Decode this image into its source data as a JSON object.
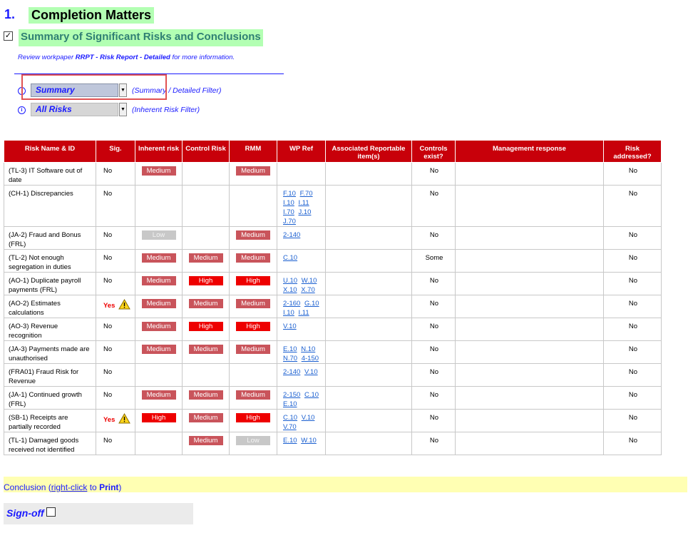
{
  "section": {
    "number": "1.",
    "title": "Completion Matters"
  },
  "summary": {
    "checked": true,
    "check_glyph": "✓",
    "title": "Summary of Significant Risks and Conclusions",
    "review_prefix": "Review workpaper",
    "review_link": "RRPT - Risk Report - Detailed",
    "review_suffix": "for more information."
  },
  "filters": [
    {
      "value": "Summary",
      "hint": "(Summary / Detailed Filter)",
      "info_glyph": "i",
      "arrow": "▼"
    },
    {
      "value": "All Risks",
      "hint": "(Inherent Risk Filter)",
      "info_glyph": "i",
      "arrow": "▼"
    }
  ],
  "colors": {
    "header_red": "#c8000a",
    "medium": "#c9545b",
    "high": "#ee0000",
    "low": "#c8c8c8",
    "link_blue": "#1a1aff"
  },
  "table": {
    "headers": [
      "Risk Name & ID",
      "Sig.",
      "Inherent risk",
      "Control Risk",
      "RMM",
      "WP Ref",
      "Associated Reportable item(s)",
      "Controls exist?",
      "Management response",
      "Risk addressed?"
    ],
    "rows": [
      {
        "name": "(TL-3) IT Software out of date",
        "sig": "No",
        "sig_warn": false,
        "inherent": "Medium",
        "control": "",
        "rmm": "Medium",
        "wp": [],
        "assoc": "",
        "controls": "No",
        "mgmt": "",
        "addressed": "No"
      },
      {
        "name": "(CH-1) Discrepancies",
        "sig": "No",
        "sig_warn": false,
        "inherent": "",
        "control": "",
        "rmm": "",
        "wp": [
          "F.10",
          "F.70",
          "I.10",
          "I.11",
          "I.70",
          "J.10",
          "J.70"
        ],
        "assoc": "",
        "controls": "No",
        "mgmt": "",
        "addressed": "No"
      },
      {
        "name": "(JA-2) Fraud and Bonus (FRL)",
        "sig": "No",
        "sig_warn": false,
        "inherent": "Low",
        "control": "",
        "rmm": "Medium",
        "wp": [
          "2-140"
        ],
        "assoc": "",
        "controls": "No",
        "mgmt": "",
        "addressed": "No"
      },
      {
        "name": "(TL-2) Not enough segregation in duties",
        "sig": "No",
        "sig_warn": false,
        "inherent": "Medium",
        "control": "Medium",
        "rmm": "Medium",
        "wp": [
          "C.10"
        ],
        "assoc": "",
        "controls": "Some",
        "mgmt": "",
        "addressed": "No"
      },
      {
        "name": "(AO-1) Duplicate payroll payments (FRL)",
        "sig": "No",
        "sig_warn": false,
        "inherent": "Medium",
        "control": "High",
        "rmm": "High",
        "wp": [
          "U.10",
          "W.10",
          "X.10",
          "X.70"
        ],
        "assoc": "",
        "controls": "No",
        "mgmt": "",
        "addressed": "No"
      },
      {
        "name": "(AO-2) Estimates calculations",
        "sig": "Yes",
        "sig_warn": true,
        "inherent": "Medium",
        "control": "Medium",
        "rmm": "Medium",
        "wp": [
          "2-160",
          "G.10",
          "I.10",
          "I.11"
        ],
        "assoc": "",
        "controls": "No",
        "mgmt": "",
        "addressed": "No"
      },
      {
        "name": "(AO-3) Revenue recognition",
        "sig": "No",
        "sig_warn": false,
        "inherent": "Medium",
        "control": "High",
        "rmm": "High",
        "wp": [
          "V.10"
        ],
        "assoc": "",
        "controls": "No",
        "mgmt": "",
        "addressed": "No"
      },
      {
        "name": "(JA-3) Payments made are unauthorised",
        "sig": "No",
        "sig_warn": false,
        "inherent": "Medium",
        "control": "Medium",
        "rmm": "Medium",
        "wp": [
          "E.10",
          "N.10",
          "N.70",
          "4-150"
        ],
        "assoc": "",
        "controls": "No",
        "mgmt": "",
        "addressed": "No"
      },
      {
        "name": "(FRA01) Fraud Risk for Revenue",
        "sig": "No",
        "sig_warn": false,
        "inherent": "",
        "control": "",
        "rmm": "",
        "wp": [
          "2-140",
          "V.10"
        ],
        "assoc": "",
        "controls": "No",
        "mgmt": "",
        "addressed": "No"
      },
      {
        "name": "(JA-1) Continued growth (FRL)",
        "sig": "No",
        "sig_warn": false,
        "inherent": "Medium",
        "control": "Medium",
        "rmm": "Medium",
        "wp": [
          "2-150",
          "C.10",
          "E.10"
        ],
        "assoc": "",
        "controls": "No",
        "mgmt": "",
        "addressed": "No"
      },
      {
        "name": "(SB-1) Receipts are partially recorded",
        "sig": "Yes",
        "sig_warn": true,
        "inherent": "High",
        "control": "Medium",
        "rmm": "High",
        "wp": [
          "C.10",
          "V.10",
          "V.70"
        ],
        "assoc": "",
        "controls": "No",
        "mgmt": "",
        "addressed": "No"
      },
      {
        "name": "(TL-1) Damaged goods received not identified",
        "sig": "No",
        "sig_warn": false,
        "inherent": "",
        "control": "Medium",
        "rmm": "Low",
        "wp": [
          "E.10",
          "W.10"
        ],
        "assoc": "",
        "controls": "No",
        "mgmt": "",
        "addressed": "No"
      }
    ]
  },
  "conclusion": {
    "prefix": "Conclusion (",
    "link": "right-click",
    "middle": " to ",
    "bold": "Print",
    "suffix": ")"
  },
  "signoff": {
    "label": "Sign-off",
    "checked": false
  }
}
